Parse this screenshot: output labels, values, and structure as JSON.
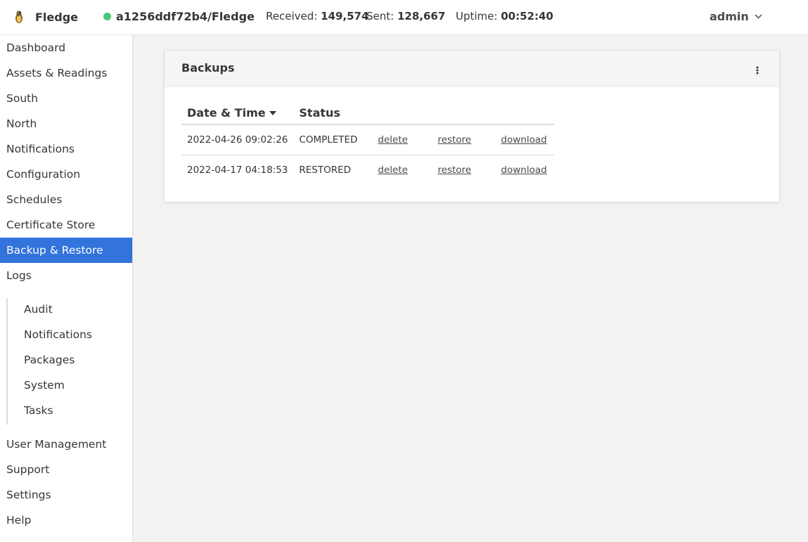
{
  "header": {
    "app_name": "Fledge",
    "service_name": "a1256ddf72b4/Fledge",
    "received_label": "Received:",
    "received_value": "149,574",
    "sent_label": "Sent:",
    "sent_value": "128,667",
    "uptime_label": "Uptime:",
    "uptime_value": "00:52:40",
    "user": "admin",
    "status_color": "#48c774"
  },
  "sidebar": {
    "items": [
      {
        "label": "Dashboard"
      },
      {
        "label": "Assets & Readings"
      },
      {
        "label": "South"
      },
      {
        "label": "North"
      },
      {
        "label": "Notifications"
      },
      {
        "label": "Configuration"
      },
      {
        "label": "Schedules"
      },
      {
        "label": "Certificate Store"
      },
      {
        "label": "Backup & Restore",
        "active": true
      },
      {
        "label": "Logs"
      }
    ],
    "log_items": [
      {
        "label": "Audit"
      },
      {
        "label": "Notifications"
      },
      {
        "label": "Packages"
      },
      {
        "label": "System"
      },
      {
        "label": "Tasks"
      }
    ],
    "bottom_items": [
      {
        "label": "User Management"
      },
      {
        "label": "Support"
      },
      {
        "label": "Settings"
      },
      {
        "label": "Help"
      }
    ],
    "active_color": "#3273dc"
  },
  "backups": {
    "title": "Backups",
    "columns": {
      "date": "Date & Time",
      "status": "Status"
    },
    "rows": [
      {
        "date": "2022-04-26 09:02:26",
        "status": "COMPLETED",
        "delete": "delete",
        "restore": "restore",
        "download": "download"
      },
      {
        "date": "2022-04-17 04:18:53",
        "status": "RESTORED",
        "delete": "delete",
        "restore": "restore",
        "download": "download"
      }
    ]
  }
}
